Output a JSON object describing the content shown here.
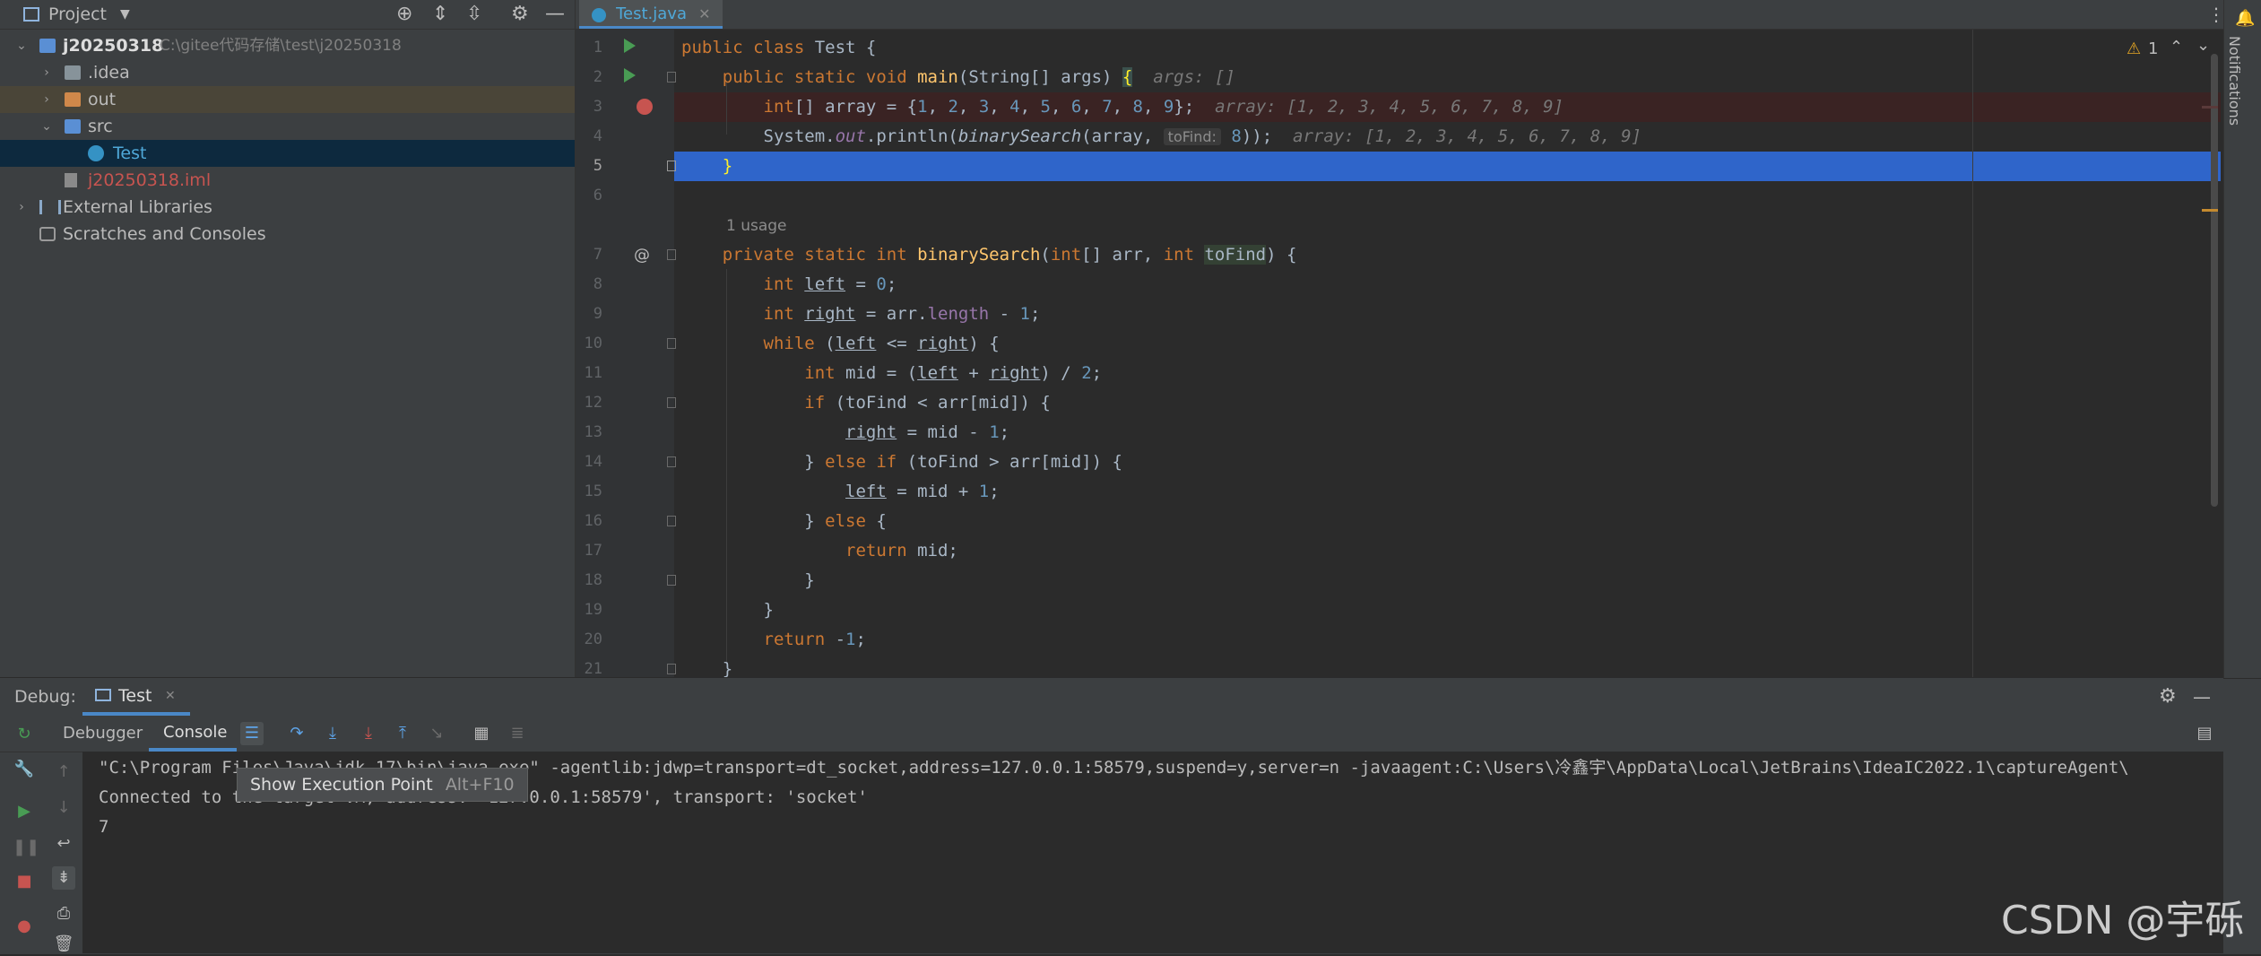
{
  "project": {
    "title": "Project",
    "tree": [
      {
        "label": "j20250318",
        "path": "C:\\gitee代码存储\\test\\j20250318"
      },
      {
        "label": ".idea"
      },
      {
        "label": "out"
      },
      {
        "label": "src"
      },
      {
        "label": "Test"
      },
      {
        "label": "j20250318.iml"
      },
      {
        "label": "External Libraries"
      },
      {
        "label": "Scratches and Consoles"
      }
    ]
  },
  "editor": {
    "tab": "Test.java",
    "warnings": "1",
    "usage_hint": "1 usage",
    "line_numbers": [
      "1",
      "2",
      "3",
      "4",
      "5",
      "6",
      "7",
      "8",
      "9",
      "10",
      "11",
      "12",
      "13",
      "14",
      "15",
      "16",
      "17",
      "18",
      "19",
      "20",
      "21"
    ],
    "hints": {
      "args": "args: []",
      "array3": "array: [1, 2, 3, 4, 5, 6, 7, 8, 9]",
      "param_toFind": "toFind:",
      "array4": "array: [1, 2, 3, 4, 5, 6, 7, 8, 9]"
    }
  },
  "debug": {
    "label": "Debug:",
    "session_tab": "Test",
    "tabs": [
      "Debugger",
      "Console"
    ],
    "tooltip": {
      "text": "Show Execution Point",
      "shortcut": "Alt+F10"
    },
    "console_lines": [
      "\"C:\\Program Files\\Java\\jdk-17\\bin\\java.exe\" -agentlib:jdwp=transport=dt_socket,address=127.0.0.1:58579,suspend=y,server=n -javaagent:C:\\Users\\冷鑫宇\\AppData\\Local\\JetBrains\\IdeaIC2022.1\\captureAgent\\",
      "Connected to the target VM, address: '127.0.0.1:58579', transport: 'socket'",
      "7"
    ]
  },
  "right_strip": {
    "notifications": "Notifications"
  },
  "watermark": "CSDN @宇砾",
  "colors": {
    "keyword": "#cc7832",
    "function": "#ffc66d",
    "number": "#6897bb",
    "field": "#9876aa",
    "selection": "#2f65ca",
    "breakpoint_line": "#3a2323"
  }
}
